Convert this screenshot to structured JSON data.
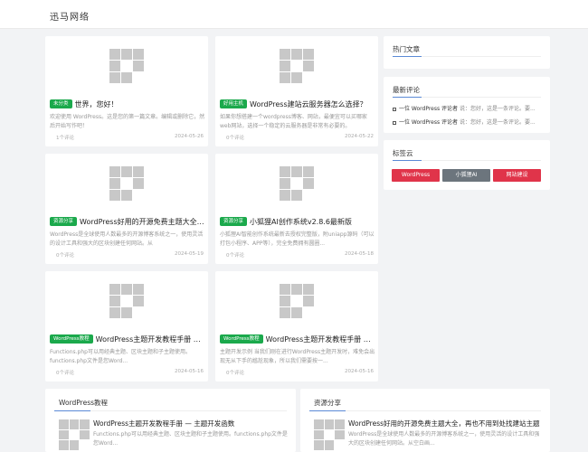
{
  "header": {
    "site_title": "迅马网络"
  },
  "posts": [
    {
      "tag": "未分类",
      "tag_color": "#1ba94c",
      "title": "世界，您好！",
      "excerpt": "欢迎使用 WordPress。这是您的第一篇文章。编辑或删除它，然后开始写作吧！",
      "comments": "1个评论",
      "date": "2024-05-26"
    },
    {
      "tag": "好用主机",
      "tag_color": "#1ba94c",
      "title": "WordPress建站云服务器怎么选择？",
      "excerpt": "如果你想搭建一个wordpress博客、网站，最便宜可以买哪家web网站，选择一个稳定的云服务器是非常有必要的。",
      "comments": "0个评论",
      "date": "2024-05-22"
    },
    {
      "tag": "资源分享",
      "tag_color": "#1ba94c",
      "title": "WordPress好用的开源免费主题大全，再也不用到处找建站主题",
      "excerpt": "WordPress是全球使用人数最多的开源博客系统之一，使用灵活的设计工具和强大的区块创建任何网站。从",
      "comments": "0个评论",
      "date": "2024-05-19"
    },
    {
      "tag": "资源分享",
      "tag_color": "#1ba94c",
      "title": "小狐狸AI创作系统v2.8.6最新版",
      "excerpt": "小狐狸AI智能创作系统最新去授权完整版，附uniapp源码（可以打包小程序、APP等），完全免费拥有圆圈...",
      "comments": "0个评论",
      "date": "2024-05-18"
    },
    {
      "tag": "WordPress教程",
      "tag_color": "#1ba94c",
      "title": "WordPress主题开发教程手册 — 主题开发函数",
      "excerpt": "Functions.php可以用经典主题、区块主题和子主题使用。functions.php文件是您Word...",
      "comments": "0个评论",
      "date": "2024-05-16"
    },
    {
      "tag": "WordPress教程",
      "tag_color": "#1ba94c",
      "title": "WordPress主题开发教程手册 — 主题开发",
      "excerpt": "主题开发示例 当我们刚在进行WordPress主题开发时，难免会出现无从下手的尴尬现象，所以我们需要按一...",
      "comments": "0个评论",
      "date": "2024-05-16"
    }
  ],
  "sidebar": {
    "hot_title": "热门文章",
    "recent_comments_title": "最新评论",
    "comments": [
      {
        "text": "一位 WordPress 评论者",
        "sep": "说：",
        "excerpt": "您好，这是一条评论。要..."
      },
      {
        "text": "一位 WordPress 评论者",
        "sep": "说：",
        "excerpt": "您好，这是一条评论。要..."
      }
    ],
    "tags_title": "标签云",
    "tags": [
      {
        "label": "WordPress",
        "color": "#e0344a"
      },
      {
        "label": "小狐狸AI",
        "color": "#6c757d"
      },
      {
        "label": "网站建设",
        "color": "#e0344a"
      }
    ]
  },
  "sections": [
    {
      "title": "WordPress教程",
      "post_title": "WordPress主题开发教程手册 — 主题开发函数",
      "post_excerpt": "Functions.php可以用经典主题、区块主题和子主题使用。functions.php文件是您Word..."
    },
    {
      "title": "资源分享",
      "post_title": "WordPress好用的开源免费主题大全，再也不用到处找建站主题",
      "post_excerpt": "WordPress是全球使用人数最多的开源博客系统之一，使用灵活的设计工具和强大的区块创建任何网站。从空白画..."
    }
  ]
}
